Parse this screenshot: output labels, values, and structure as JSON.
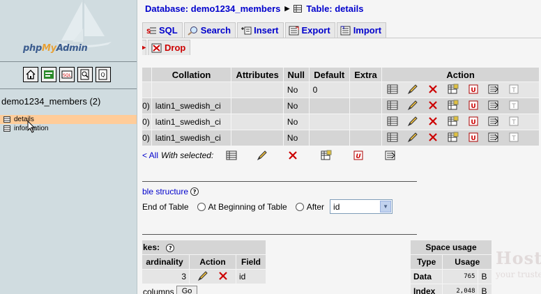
{
  "left": {
    "logo": {
      "php": "php",
      "my": "My",
      "admin": "Admin"
    },
    "buttons": [
      "home-icon",
      "sql-query-window-icon",
      "sql-icon",
      "docs-icon",
      "query-icon"
    ],
    "db_name": "demo1234_members (2)",
    "tables": [
      {
        "name": "details",
        "selected": true
      },
      {
        "name": "information",
        "selected": false
      }
    ]
  },
  "right": {
    "breadcrumb": {
      "database": "Database: demo1234_members",
      "table": "Table: details"
    },
    "tabs": [
      {
        "label": "SQL",
        "icon": "sql-icon"
      },
      {
        "label": "Search",
        "icon": "search-icon"
      },
      {
        "label": "Insert",
        "icon": "insert-icon"
      },
      {
        "label": "Export",
        "icon": "export-icon"
      },
      {
        "label": "Import",
        "icon": "import-icon"
      }
    ],
    "drop_tab": "Drop",
    "structure": {
      "headers": [
        "Collation",
        "Attributes",
        "Null",
        "Default",
        "Extra",
        "Action"
      ],
      "rows": [
        {
          "pre": "",
          "collation": "",
          "attributes": "",
          "null": "No",
          "default": "0",
          "extra": ""
        },
        {
          "pre": "0)",
          "collation": "latin1_swedish_ci",
          "attributes": "",
          "null": "No",
          "default": "",
          "extra": ""
        },
        {
          "pre": "0)",
          "collation": "latin1_swedish_ci",
          "attributes": "",
          "null": "No",
          "default": "",
          "extra": ""
        },
        {
          "pre": "0)",
          "collation": "latin1_swedish_ci",
          "attributes": "",
          "null": "No",
          "default": "",
          "extra": ""
        }
      ]
    },
    "with_selected": {
      "check": "< All",
      "label": "With selected:"
    },
    "add_field": {
      "label": "ble structure",
      "end": "End of Table",
      "begin": "At Beginning of Table",
      "after": "After",
      "after_value": "id"
    },
    "indexes": {
      "caption": "kes:",
      "headers": [
        "ardinality",
        "Action",
        "Field"
      ],
      "row": {
        "cardinality": "3",
        "field": "id"
      },
      "footer": "columns",
      "go": "Go"
    },
    "space": {
      "caption": "Space usage",
      "headers": [
        "Type",
        "Usage"
      ],
      "rows": [
        {
          "type": "Data",
          "value": "765",
          "unit": "B"
        },
        {
          "type": "Index",
          "value": "2,048",
          "unit": "B"
        }
      ]
    },
    "watermark": {
      "brand": "HostASP",
      "tagline": "your trusted application service provider"
    }
  },
  "colors": {
    "link": "#0000cc",
    "drop": "#cc0000",
    "selected_row": "#ffcc99",
    "left_bg": "#d0dce0"
  }
}
